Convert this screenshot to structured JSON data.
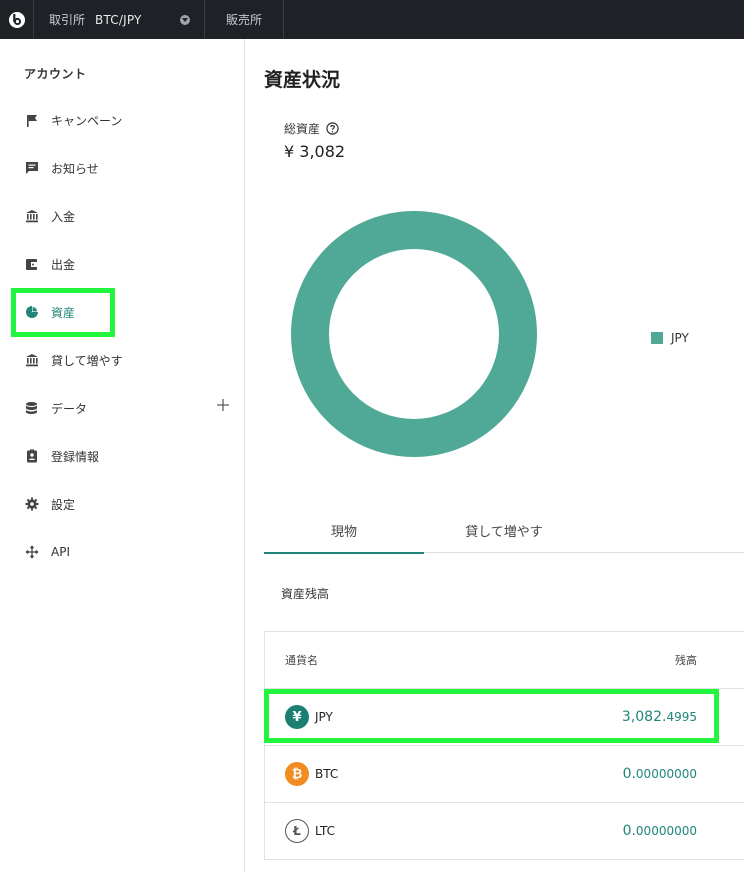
{
  "header": {
    "exchange_label": "取引所",
    "pair": "BTC/JPY",
    "sales_label": "販売所"
  },
  "sidebar": {
    "heading": "アカウント",
    "items": [
      {
        "label": "キャンペーン",
        "icon": "flag-icon"
      },
      {
        "label": "お知らせ",
        "icon": "message-icon"
      },
      {
        "label": "入金",
        "icon": "bank-icon"
      },
      {
        "label": "出金",
        "icon": "wallet-icon"
      },
      {
        "label": "資産",
        "icon": "pie-chart-icon",
        "active": true
      },
      {
        "label": "貸して増やす",
        "icon": "bank-icon"
      },
      {
        "label": "データ",
        "icon": "database-icon",
        "expandable": true
      },
      {
        "label": "登録情報",
        "icon": "id-badge-icon"
      },
      {
        "label": "設定",
        "icon": "gear-icon"
      },
      {
        "label": "API",
        "icon": "api-icon"
      }
    ]
  },
  "main": {
    "title": "資産状況",
    "total_label": "総資産",
    "total_value": "¥ 3,082",
    "chart_data": {
      "type": "pie",
      "categories": [
        "JPY"
      ],
      "values": [
        100
      ],
      "colors": [
        "#50a996"
      ],
      "legend": "right"
    },
    "tabs": [
      {
        "label": "現物",
        "active": true
      },
      {
        "label": "貸して増やす",
        "active": false
      }
    ],
    "section_title": "資産残高",
    "table": {
      "headers": [
        "通貨名",
        "残高"
      ],
      "rows": [
        {
          "currency": "JPY",
          "balance_main": "3,082.",
          "balance_frac": "4995",
          "icon": "yen-coin-icon"
        },
        {
          "currency": "BTC",
          "balance_main": "0.",
          "balance_frac": "00000000",
          "icon": "bitcoin-coin-icon"
        },
        {
          "currency": "LTC",
          "balance_main": "0.",
          "balance_frac": "00000000",
          "icon": "litecoin-coin-icon"
        }
      ]
    }
  },
  "colors": {
    "accent": "#21857a",
    "donut": "#50a996",
    "topbar": "#1e2126",
    "highlight": "#22f53d"
  }
}
